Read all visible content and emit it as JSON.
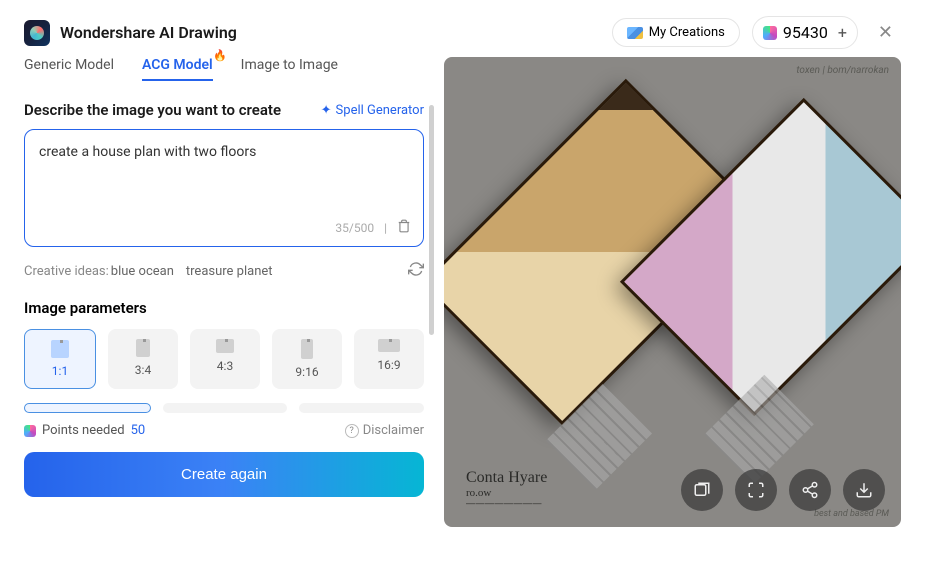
{
  "app": {
    "title": "Wondershare AI Drawing"
  },
  "header": {
    "my_creations": "My Creations",
    "credits": "95430"
  },
  "tabs": {
    "generic": "Generic Model",
    "acg": "ACG Model",
    "i2i": "Image to Image"
  },
  "prompt": {
    "label": "Describe the image you want to create",
    "spell_gen": "Spell Generator",
    "value": "create a house plan with two floors",
    "counter": "35/500"
  },
  "ideas": {
    "prefix": "Creative ideas:",
    "idea1": "blue ocean",
    "idea2": "treasure planet"
  },
  "params": {
    "label": "Image parameters",
    "ratios": [
      "1:1",
      "3:4",
      "4:3",
      "9:16",
      "16:9"
    ]
  },
  "footer": {
    "points_label": "Points needed",
    "points_value": "50",
    "disclaimer": "Disclaimer"
  },
  "cta": "Create again",
  "result": {
    "wm_tr": "toxen | bom/narrokan",
    "wm_br": "best and based PM",
    "sig_main": "Conta Hyare",
    "sig_r": "ro.ow",
    "sig_sub": "————————"
  }
}
